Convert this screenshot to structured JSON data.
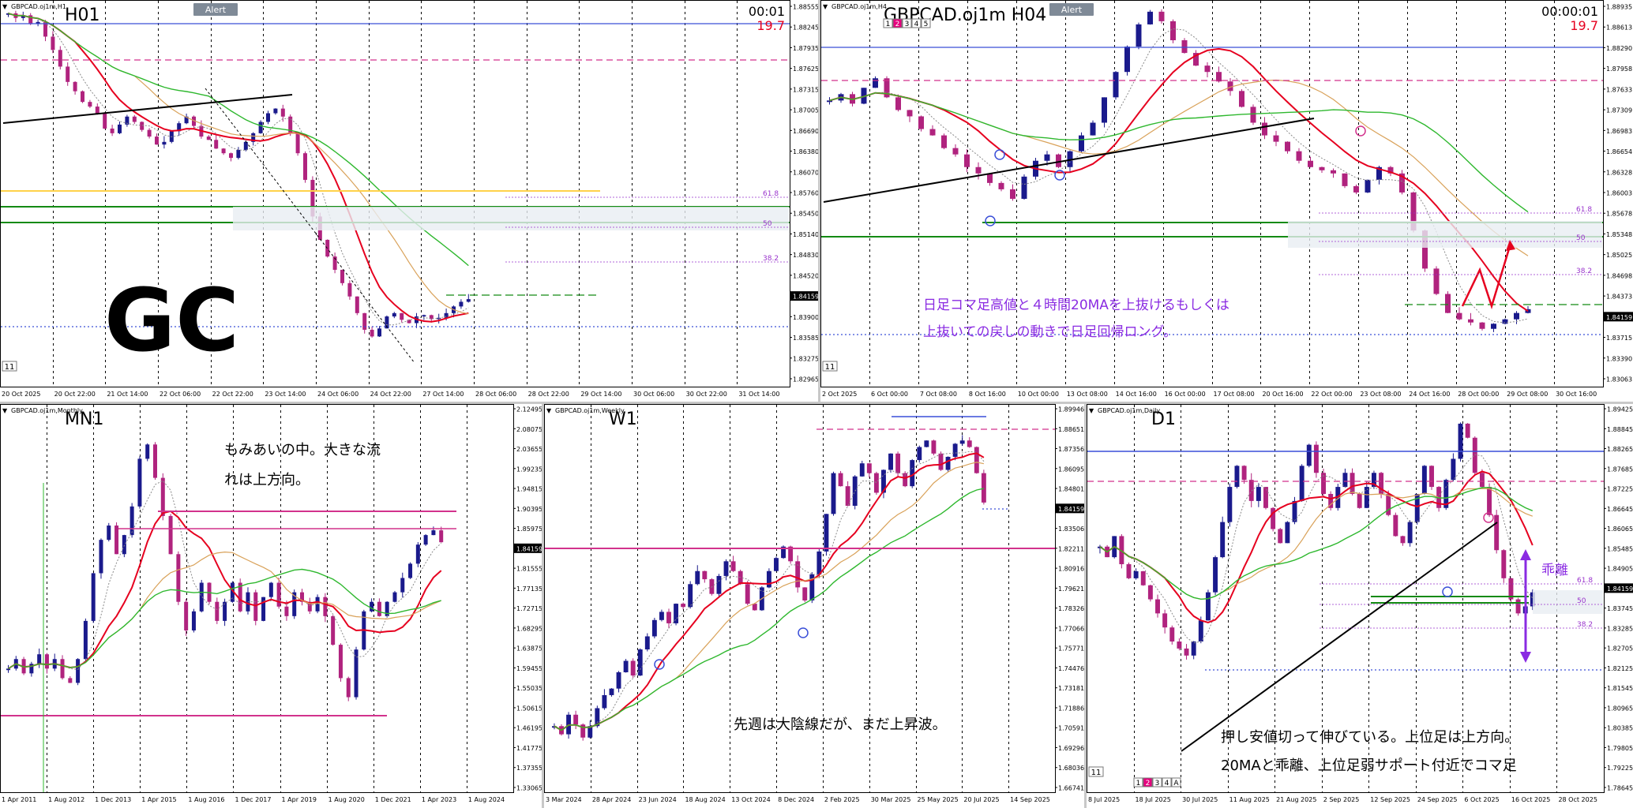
{
  "colors": {
    "up": "#1a1a8c",
    "down": "#b0237e",
    "ma_red": "#e6001f",
    "ma_green": "#2fb82f",
    "ma_tan": "#d9a25a",
    "ma_gray": "#8a8a8a",
    "level_blue": "#3a4fd8",
    "level_pink": "#d2328c",
    "level_green": "#138a13",
    "fib_purple": "#9933cc",
    "annotation_purple": "#8a2be2",
    "grid": "#000000",
    "bid_box": "#000000"
  },
  "panels": [
    {
      "key": "h1",
      "window_title": "GBPCAD.oj1m,H1",
      "label": "H01",
      "alert_label": "Alert",
      "timer": "00:01",
      "spread": "19.7",
      "bid": "1.84159",
      "big_text": "GC",
      "note": "",
      "bottom_tag": "11",
      "price_labels": [
        "1.88555",
        "1.88245",
        "1.87935",
        "1.87625",
        "1.87315",
        "1.87005",
        "1.86690",
        "1.86380",
        "1.86070",
        "1.85760",
        "1.85450",
        "1.85140",
        "1.84830",
        "1.84520",
        "1.84159",
        "1.83900",
        "1.83585",
        "1.83275",
        "1.82965"
      ],
      "time_labels": [
        "20 Oct 2025",
        "20 Oct 22:00",
        "21 Oct 14:00",
        "22 Oct 06:00",
        "22 Oct 22:00",
        "23 Oct 14:00",
        "24 Oct 06:00",
        "24 Oct 22:00",
        "27 Oct 14:00",
        "28 Oct 06:00",
        "28 Oct 22:00",
        "29 Oct 14:00",
        "30 Oct 06:00",
        "30 Oct 22:00",
        "31 Oct 14:00"
      ],
      "fib_labels": [
        "61.8",
        "50",
        "38.2"
      ],
      "price_range": [
        1.82965,
        1.88555
      ],
      "chart_data": {
        "type": "candlestick",
        "timeframe": "H1",
        "ylim": [
          1.82965,
          1.88555
        ],
        "last_price": 1.84159,
        "path": [
          1.8845,
          1.8838,
          1.8842,
          1.883,
          1.8832,
          1.881,
          1.879,
          1.8765,
          1.8742,
          1.8728,
          1.8712,
          1.8705,
          1.8695,
          1.8672,
          1.8665,
          1.8678,
          1.869,
          1.8682,
          1.867,
          1.866,
          1.8648,
          1.8652,
          1.8668,
          1.868,
          1.869,
          1.8676,
          1.866,
          1.8655,
          1.8642,
          1.8635,
          1.8628,
          1.864,
          1.8652,
          1.8665,
          1.8682,
          1.8695,
          1.8702,
          1.869,
          1.8665,
          1.8635,
          1.8595,
          1.854,
          1.8505,
          1.848,
          1.846,
          1.844,
          1.842,
          1.8395,
          1.837,
          1.836,
          1.8372,
          1.839,
          1.8395,
          1.8385,
          1.838,
          1.839,
          1.8392,
          1.8386,
          1.8388,
          1.8395,
          1.8405,
          1.8412,
          1.8416
        ]
      }
    },
    {
      "key": "h4",
      "window_title": "GBPCAD.oj1m,H4",
      "label": "GBPCAD.oj1m H04",
      "alert_label": "Alert",
      "timer": "00:00:01",
      "spread": "19.7",
      "bid": "1.84159",
      "big_text": "",
      "note": "日足コマ足高値と４時間20MAを上抜けるもしくは\n上抜いての戻しの動きで日足回帰ロング。",
      "bottom_tag": "11",
      "tabs": [
        "1",
        "2",
        "3",
        "4",
        "5"
      ],
      "price_labels": [
        "1.88935",
        "1.88613",
        "1.88290",
        "1.87958",
        "1.87633",
        "1.87309",
        "1.86983",
        "1.86654",
        "1.86328",
        "1.86003",
        "1.85678",
        "1.85348",
        "1.85025",
        "1.84698",
        "1.84373",
        "1.84159",
        "1.83715",
        "1.83390",
        "1.83063"
      ],
      "time_labels": [
        "2 Oct 2025",
        "6 Oct 00:00",
        "7 Oct 08:00",
        "8 Oct 16:00",
        "10 Oct 00:00",
        "13 Oct 08:00",
        "14 Oct 16:00",
        "16 Oct 00:00",
        "17 Oct 08:00",
        "20 Oct 16:00",
        "22 Oct 00:00",
        "23 Oct 08:00",
        "24 Oct 16:00",
        "28 Oct 00:00",
        "29 Oct 08:00",
        "30 Oct 16:00"
      ],
      "fib_labels": [
        "61.8",
        "50",
        "38.2"
      ],
      "price_range": [
        1.83063,
        1.88935
      ],
      "chart_data": {
        "type": "candlestick",
        "timeframe": "H4",
        "ylim": [
          1.83063,
          1.88935
        ],
        "last_price": 1.84159,
        "path": [
          1.8745,
          1.8755,
          1.874,
          1.8765,
          1.878,
          1.875,
          1.873,
          1.872,
          1.87,
          1.869,
          1.867,
          1.866,
          1.864,
          1.863,
          1.8615,
          1.8605,
          1.859,
          1.8625,
          1.865,
          1.866,
          1.864,
          1.8665,
          1.869,
          1.871,
          1.875,
          1.879,
          1.883,
          1.8865,
          1.8885,
          1.887,
          1.884,
          1.882,
          1.88,
          1.879,
          1.8775,
          1.876,
          1.8735,
          1.871,
          1.869,
          1.868,
          1.8665,
          1.865,
          1.864,
          1.8635,
          1.863,
          1.861,
          1.86,
          1.862,
          1.864,
          1.863,
          1.86,
          1.854,
          1.848,
          1.844,
          1.841,
          1.84,
          1.8395,
          1.8385,
          1.8393,
          1.84,
          1.841,
          1.8416
        ]
      }
    },
    {
      "key": "mn1",
      "window_title": "GBPCAD.oj1m,Monthly",
      "label": "MN1",
      "alert_label": "",
      "timer": "",
      "spread": "",
      "bid": "1.84159",
      "big_text": "",
      "note": "もみあいの中。大きな流\nれは上方向。",
      "bottom_tag": "",
      "price_labels": [
        "2.12495",
        "2.08075",
        "2.03655",
        "1.99235",
        "1.94815",
        "1.90395",
        "1.85975",
        "1.84159",
        "1.81555",
        "1.77135",
        "1.72715",
        "1.68295",
        "1.63875",
        "1.59455",
        "1.55035",
        "1.50615",
        "1.46195",
        "1.41775",
        "1.37355",
        "1.33065"
      ],
      "time_labels": [
        "1 Apr 2011",
        "1 Aug 2012",
        "1 Dec 2013",
        "1 Apr 2015",
        "1 Aug 2016",
        "1 Dec 2017",
        "1 Apr 2019",
        "1 Aug 2020",
        "1 Dec 2021",
        "1 Apr 2023",
        "1 Aug 2024"
      ],
      "fib_labels": [],
      "price_range": [
        1.33065,
        2.12495
      ],
      "chart_data": {
        "type": "candlestick",
        "timeframe": "MN1",
        "ylim": [
          1.33065,
          2.12495
        ],
        "last_price": 1.84159,
        "path": [
          1.58,
          1.6,
          1.57,
          1.59,
          1.61,
          1.58,
          1.6,
          1.56,
          1.55,
          1.6,
          1.68,
          1.78,
          1.85,
          1.88,
          1.82,
          1.86,
          1.92,
          2.02,
          2.05,
          1.98,
          1.9,
          1.82,
          1.72,
          1.66,
          1.7,
          1.76,
          1.72,
          1.68,
          1.72,
          1.76,
          1.7,
          1.74,
          1.68,
          1.73,
          1.76,
          1.71,
          1.69,
          1.74,
          1.72,
          1.7,
          1.73,
          1.69,
          1.63,
          1.56,
          1.52,
          1.62,
          1.7,
          1.72,
          1.69,
          1.72,
          1.74,
          1.77,
          1.8,
          1.84,
          1.86,
          1.87,
          1.845
        ]
      }
    },
    {
      "key": "w1",
      "window_title": "GBPCAD.oj1m,Weekly",
      "label": "W1",
      "alert_label": "",
      "timer": "",
      "spread": "",
      "bid": "1.84159",
      "big_text": "",
      "note": "先週は大陰線だが、まだ上昇波。",
      "bottom_tag": "",
      "price_labels": [
        "1.89946",
        "1.88651",
        "1.87356",
        "1.86095",
        "1.84801",
        "1.84159",
        "1.83506",
        "1.82211",
        "1.80916",
        "1.79621",
        "1.78326",
        "1.77066",
        "1.75771",
        "1.74476",
        "1.73181",
        "1.71886",
        "1.70591",
        "1.69296",
        "1.68036",
        "1.66741"
      ],
      "time_labels": [
        "3 Mar 2024",
        "28 Apr 2024",
        "23 Jun 2024",
        "18 Aug 2024",
        "13 Oct 2024",
        "8 Dec 2024",
        "2 Feb 2025",
        "30 Mar 2025",
        "25 May 2025",
        "20 Jul 2025",
        "14 Sep 2025"
      ],
      "fib_labels": [],
      "price_range": [
        1.66741,
        1.89946
      ],
      "chart_data": {
        "type": "candlestick",
        "timeframe": "W1",
        "ylim": [
          1.66741,
          1.89946
        ],
        "last_price": 1.84159,
        "path": [
          1.705,
          1.7,
          1.712,
          1.706,
          1.698,
          1.705,
          1.716,
          1.724,
          1.728,
          1.738,
          1.745,
          1.736,
          1.752,
          1.76,
          1.77,
          1.775,
          1.768,
          1.78,
          1.778,
          1.792,
          1.8,
          1.795,
          1.786,
          1.797,
          1.806,
          1.8,
          1.792,
          1.78,
          1.776,
          1.79,
          1.8,
          1.808,
          1.815,
          1.806,
          1.79,
          1.782,
          1.798,
          1.812,
          1.835,
          1.86,
          1.852,
          1.84,
          1.858,
          1.866,
          1.86,
          1.848,
          1.862,
          1.872,
          1.86,
          1.852,
          1.868,
          1.876,
          1.88,
          1.872,
          1.862,
          1.87,
          1.878,
          1.88,
          1.876,
          1.86,
          1.842
        ]
      }
    },
    {
      "key": "d1",
      "window_title": "GBPCAD.oj1m,Daily",
      "label": "D1",
      "alert_label": "",
      "timer": "",
      "spread": "",
      "bid": "1.84159",
      "big_text": "",
      "note": "押し安値切って伸びている。上位足は上方向。\n20MAと乖離、上位足弱サポート付近でコマ足",
      "divergence_label": "乖離",
      "bottom_tag": "11",
      "tabs": [
        "1",
        "2",
        "3",
        "4",
        "A"
      ],
      "price_labels": [
        "1.89425",
        "1.88845",
        "1.88265",
        "1.87685",
        "1.87225",
        "1.86645",
        "1.86065",
        "1.85485",
        "1.84905",
        "1.84159",
        "1.83745",
        "1.83285",
        "1.82705",
        "1.82125",
        "1.81545",
        "1.80965",
        "1.80385",
        "1.79805",
        "1.79225",
        "1.78645"
      ],
      "time_labels": [
        "8 Jul 2025",
        "18 Jul 2025",
        "30 Jul 2025",
        "11 Aug 2025",
        "21 Aug 2025",
        "2 Sep 2025",
        "12 Sep 2025",
        "24 Sep 2025",
        "6 Oct 2025",
        "16 Oct 2025",
        "28 Oct 2025"
      ],
      "fib_labels": [
        "61.8",
        "50",
        "38.2"
      ],
      "price_range": [
        1.78645,
        1.89425
      ],
      "chart_data": {
        "type": "candlestick",
        "timeframe": "D1",
        "ylim": [
          1.78645,
          1.89425
        ],
        "last_price": 1.84159,
        "path": [
          1.855,
          1.852,
          1.858,
          1.85,
          1.846,
          1.848,
          1.844,
          1.84,
          1.836,
          1.832,
          1.828,
          1.826,
          1.824,
          1.828,
          1.834,
          1.842,
          1.852,
          1.862,
          1.872,
          1.878,
          1.874,
          1.868,
          1.872,
          1.866,
          1.86,
          1.856,
          1.862,
          1.868,
          1.878,
          1.884,
          1.876,
          1.87,
          1.866,
          1.872,
          1.876,
          1.87,
          1.866,
          1.872,
          1.876,
          1.87,
          1.864,
          1.858,
          1.856,
          1.862,
          1.87,
          1.878,
          1.872,
          1.866,
          1.874,
          1.88,
          1.89,
          1.886,
          1.876,
          1.872,
          1.864,
          1.854,
          1.846,
          1.84,
          1.836,
          1.838,
          1.842
        ]
      }
    }
  ]
}
